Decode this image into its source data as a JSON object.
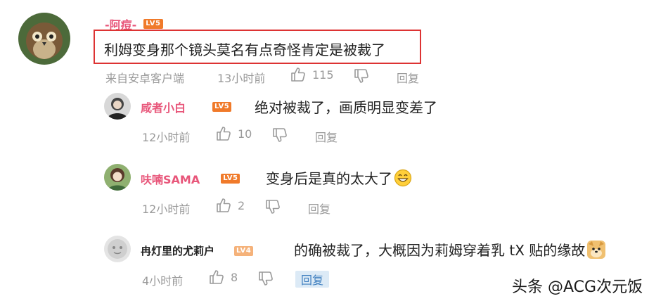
{
  "main_comment": {
    "username": "-阿痘-",
    "level_badge": "LV5",
    "text": "利姆变身那个镜头莫名有点奇怪肯定是被裁了",
    "source": "来自安卓客户端",
    "time": "13小时前",
    "likes": "115",
    "reply_label": "回复"
  },
  "replies": [
    {
      "username": "咸者小白",
      "level_badge": "LV5",
      "text": "绝对被裁了，画质明显变差了",
      "time": "12小时前",
      "likes": "10",
      "reply_label": "回复"
    },
    {
      "username": "呋喃SAMA",
      "level_badge": "LV5",
      "text": "变身后是真的太大了",
      "time": "12小时前",
      "likes": "2",
      "reply_label": "回复"
    },
    {
      "username": "冉灯里的尤莉户",
      "level_badge": "LV4",
      "text": "的确被裁了，大概因为莉姆穿着乳 tX 贴的缘故",
      "time": "4小时前",
      "likes": "8",
      "reply_label": "回复"
    }
  ],
  "watermark": "头条 @ACG次元饭",
  "colors": {
    "username": "#e8567a",
    "badge_lv5": "#f07a2a",
    "badge_lv4": "#f5b27a",
    "highlight_border": "#dd3333"
  }
}
